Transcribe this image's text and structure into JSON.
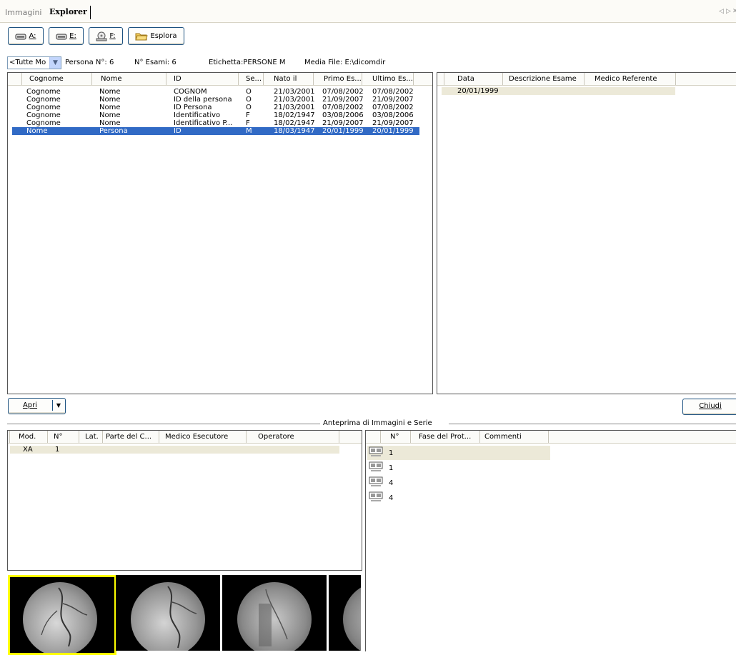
{
  "tabs": {
    "immagini": "Immagini",
    "explorer": "Explorer",
    "nav_left": "◁",
    "nav_right": "▷",
    "nav_close": "✕"
  },
  "toolbar": {
    "drive_a": "A:",
    "drive_e": "E:",
    "drive_f": "F:",
    "esplora": "Esplora"
  },
  "filter": {
    "modality_value": "<Tutte Mo",
    "persona_count": "Persona N°: 6",
    "esami_count": "N° Esami: 6",
    "etichetta": "Etichetta:PERSONE M",
    "media_file": "Media File: E:\\dicomdir"
  },
  "patients": {
    "columns": [
      "Cognome",
      "Nome",
      "ID",
      "Se...",
      "Nato il",
      "Primo Es...",
      "Ultimo Es..."
    ],
    "rows": [
      [
        "Cognome",
        "Nome",
        "COGNOM",
        "O",
        "21/03/2001",
        "07/08/2002",
        "07/08/2002"
      ],
      [
        "Cognome",
        "Nome",
        "ID della persona",
        "O",
        "21/03/2001",
        "21/09/2007",
        "21/09/2007"
      ],
      [
        "Cognome",
        "Nome",
        "ID Persona",
        "O",
        "21/03/2001",
        "07/08/2002",
        "07/08/2002"
      ],
      [
        "Cognome",
        "Nome",
        "Identificativo",
        "F",
        "18/02/1947",
        "03/08/2006",
        "03/08/2006"
      ],
      [
        "Cognome",
        "Nome",
        "Identificativo P...",
        "F",
        "18/02/1947",
        "21/09/2007",
        "21/09/2007"
      ],
      [
        "Nome",
        "Persona",
        "ID",
        "M",
        "18/03/1947",
        "20/01/1999",
        "20/01/1999"
      ]
    ],
    "selected_index": 5
  },
  "exams": {
    "columns": [
      "Data",
      "Descrizione Esame",
      "Medico Referente"
    ],
    "rows": [
      [
        "20/01/1999",
        "",
        ""
      ]
    ]
  },
  "buttons": {
    "apri": "Apri",
    "chiudi": "Chiudi"
  },
  "preview": {
    "title": "Anteprima di Immagini e Serie",
    "series_columns": [
      "Mod.",
      "N°",
      "Lat.",
      "Parte del C...",
      "Medico Esecutore",
      "Operatore"
    ],
    "series_rows": [
      [
        "XA",
        "1",
        "",
        "",
        "",
        ""
      ]
    ],
    "images_columns": [
      "N°",
      "Fase del Prot...",
      "Commenti"
    ],
    "images_rows": [
      "1",
      "1",
      "4",
      "4"
    ]
  },
  "colors": {
    "selection": "#316ac5",
    "thumb_highlight": "#ffff00",
    "border": "#1c5180"
  }
}
